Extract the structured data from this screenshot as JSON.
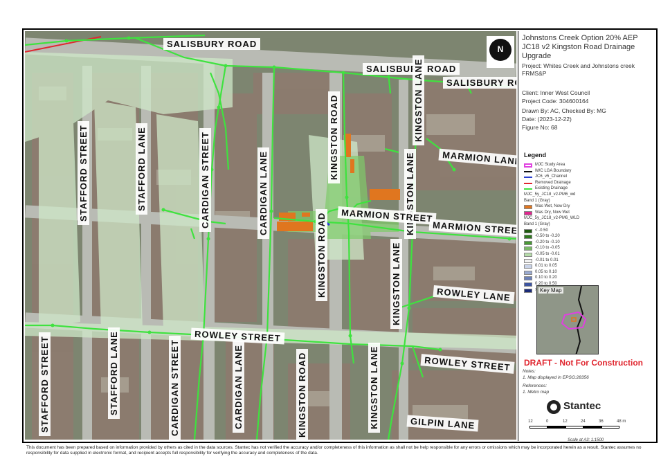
{
  "title": {
    "line1": "Johnstons Creek Option 20% AEP",
    "line2": "JC18 v2 Kingston Road Drainage",
    "line3": "Upgrade"
  },
  "project": "Project:   Whites Creek and Johnstons creek FRMS&P",
  "client": "Client:   Inner West Council",
  "project_code": "Project Code:   304600164",
  "drawn_by": "Drawn By:   AC,  Checked By:  MG",
  "date": "Date:   (2023-12-22)",
  "figure_no": "Figure No:   68",
  "north_label": "N",
  "streets": {
    "salisbury_1": "SALISBURY ROAD",
    "salisbury_2": "SALISBURY ROAD",
    "salisbury_3": "SALISBURY ROAD",
    "stafford_st_1": "STAFFORD STREET",
    "stafford_lane_1": "STAFFORD LANE",
    "cardigan_st_1": "CARDIGAN STREET",
    "cardigan_lane_1": "CARDIGAN LANE",
    "kingston_road_1": "KINGSTON ROAD",
    "kingston_lane_1": "KINGSTON LANE",
    "kingston_lane_2": "KINGSTON LANE",
    "marmion_lane": "MARMION LANE",
    "marmion_st_1": "MARMION STREET",
    "marmion_st_2": "MARMION STREET",
    "kingston_road_2": "KINGSTON ROAD",
    "kingston_lane_3": "KINGSTON LANE",
    "rowley_lane": "ROWLEY LANE",
    "rowley_st_1": "ROWLEY STREET",
    "rowley_st_2": "ROWLEY STREET",
    "stafford_st_2": "STAFFORD STREET",
    "stafford_lane_2": "STAFFORD LANE",
    "cardigan_st_2": "CARDIGAN STREET",
    "cardigan_lane_2": "CARDIGAN LANE",
    "kingston_road_3": "KINGSTON ROAD",
    "kingston_lane_4": "KINGSTON LANE",
    "gilpin_lane": "GILPIN LANE"
  },
  "legend": {
    "title": "Legend",
    "items": [
      {
        "label": "MJC Study Area",
        "color": "#e040e0"
      },
      {
        "label": "IWC LGA Boundary",
        "color": "#111111"
      },
      {
        "label": "JC6_v5_Channel",
        "color": "#2a3fd0"
      },
      {
        "label": "Removed Drainage",
        "color": "#e0262f"
      },
      {
        "label": "Existing Drainage",
        "color": "#3fe23f"
      },
      {
        "label": "MJC_5y_JC18_v2-PM6_wd",
        "color": ""
      },
      {
        "label": "Band 1 (Gray)",
        "color": ""
      },
      {
        "label": "Was Wet, Now Dry",
        "color": "#e0761f"
      },
      {
        "label": "Was Dry, Now Wet",
        "color": "#e0268f"
      },
      {
        "label": "MJC_5y_JC18_v2-PM6_WLD",
        "color": ""
      },
      {
        "label": "Band 1 (Gray)",
        "color": ""
      },
      {
        "label": "< -0.50",
        "color": "#1f5b10"
      },
      {
        "label": "-0.50 to -0.20",
        "color": "#2f7a1f"
      },
      {
        "label": "-0.20 to -0.10",
        "color": "#4a9a36"
      },
      {
        "label": "-0.10 to -0.05",
        "color": "#7ab868"
      },
      {
        "label": "-0.05 to -0.01",
        "color": "#b6dcaa"
      },
      {
        "label": "-0.01 to 0.01",
        "color": "#f2f2f2"
      },
      {
        "label": "0.01 to 0.05",
        "color": "#c9d3e8"
      },
      {
        "label": "0.05 to 0.10",
        "color": "#9aaad0"
      },
      {
        "label": "0.10 to 0.20",
        "color": "#6a7fb8"
      },
      {
        "label": "0.20 to 0.50",
        "color": "#3e55a0"
      },
      {
        "label": "> 0.50",
        "color": "#1a2a78"
      }
    ]
  },
  "key_map_label": "Key Map",
  "draft": "DRAFT - Not For Construction",
  "notes_title": "Notes:",
  "notes_1": "1. Map displayed in EPSG:28356",
  "references_title": "References:",
  "references_1": "1. Metro map",
  "logo": "Stantec",
  "scale": {
    "labels": [
      "12",
      "0",
      "12",
      "24",
      "36",
      "48 m"
    ],
    "text": "Scale at A3: 1:1500"
  },
  "disclaimer": "This document has been prepared based on information provided by others as cited in the data sources. Stantec has not verified the accuracy and/or completeness of this information as shall not be help responsible for any errors or omissions which may be incorporated herein as a result. Stantec assumes no responsibility for data supplied in electronic format, and recipient accepts full responsibility for verifying the accuracy and completeness of the data.",
  "colors": {
    "drainage": "#3fe23f",
    "removed": "#e0262f",
    "was_wet_now_dry": "#e0761f",
    "study_area": "#e040e0"
  }
}
